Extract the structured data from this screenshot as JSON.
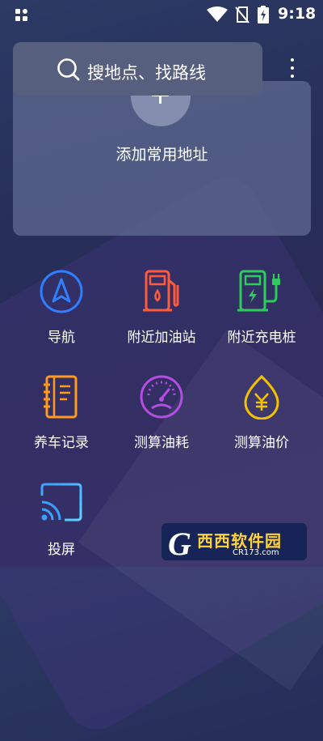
{
  "status_bar": {
    "time": "9:18",
    "icons": [
      "app-grid-icon",
      "wifi-icon",
      "no-sim-icon",
      "battery-charging-icon"
    ]
  },
  "search": {
    "placeholder": "搜地点、找路线",
    "icon": "search-icon"
  },
  "more_menu_icon": "more-vertical-icon",
  "address_card": {
    "add_label": "添加常用地址",
    "icon": "plus-icon"
  },
  "features": [
    {
      "label": "导航",
      "icon": "navigation-arrow-icon",
      "color": "#2f7fff"
    },
    {
      "label": "附近加油站",
      "icon": "gas-station-icon",
      "color": "#ff5a3c"
    },
    {
      "label": "附近充电桩",
      "icon": "charging-station-icon",
      "color": "#2ecc5a"
    },
    {
      "label": "养车记录",
      "icon": "notebook-icon",
      "color": "#ff9a1e"
    },
    {
      "label": "测算油耗",
      "icon": "gauge-icon",
      "color": "#b34ee0"
    },
    {
      "label": "测算油价",
      "icon": "price-drop-icon",
      "color": "#f2c200"
    },
    {
      "label": "投屏",
      "icon": "cast-screen-icon",
      "color": "#3aa0ff"
    }
  ],
  "watermark": {
    "letter": "G",
    "text": "西西软件园",
    "sub": "CR173.com"
  }
}
